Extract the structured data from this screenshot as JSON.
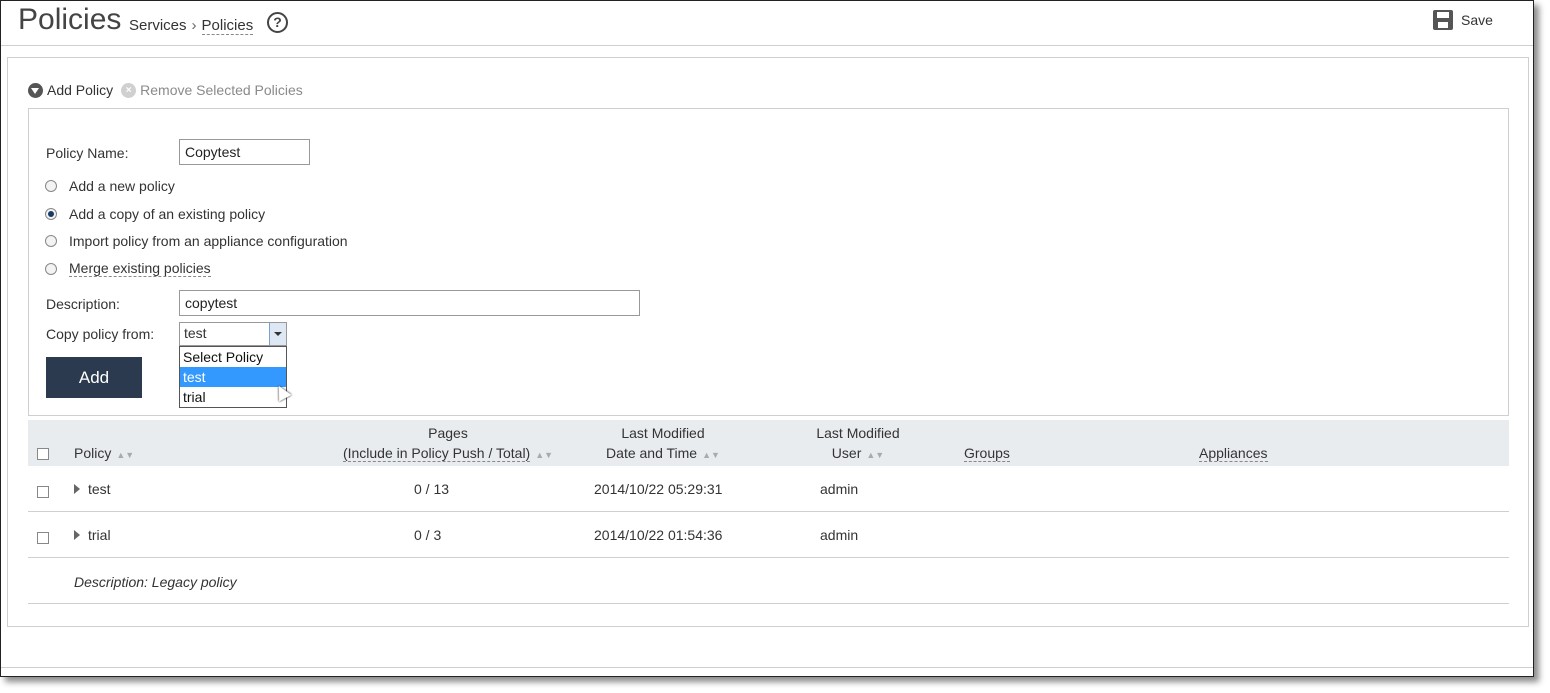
{
  "header": {
    "title": "Policies",
    "breadcrumb": {
      "parent": "Services",
      "separator": "›",
      "current": "Policies"
    },
    "help_icon": "?",
    "save_label": "Save"
  },
  "actions": {
    "add_policy": "Add Policy",
    "remove_selected": "Remove Selected Policies"
  },
  "form": {
    "policy_name_label": "Policy Name:",
    "policy_name_value": "Copytest",
    "radio_options": [
      {
        "label": "Add a new policy",
        "checked": false
      },
      {
        "label": "Add a copy of an existing policy",
        "checked": true
      },
      {
        "label": "Import policy from an appliance configuration",
        "checked": false
      },
      {
        "label": "Merge existing policies",
        "checked": false
      }
    ],
    "description_label": "Description:",
    "description_value": "copytest",
    "copy_from_label": "Copy policy from:",
    "copy_from_value": "test",
    "dropdown_options": [
      {
        "label": "Select Policy",
        "selected": false
      },
      {
        "label": "test",
        "selected": true
      },
      {
        "label": "trial",
        "selected": false
      }
    ],
    "add_button": "Add"
  },
  "table": {
    "headers": {
      "policy": "Policy",
      "pages_line1": "Pages",
      "pages_line2": "(Include in Policy Push / Total)",
      "modified_line1": "Last Modified",
      "modified_line2": "Date and Time",
      "user_line1": "Last Modified",
      "user_line2": "User",
      "groups": "Groups",
      "appliances": "Appliances"
    },
    "rows": [
      {
        "policy": "test",
        "pages": "0 / 13",
        "modified": "2014/10/22 05:29:31",
        "user": "admin"
      },
      {
        "policy": "trial",
        "pages": "0 / 3",
        "modified": "2014/10/22 01:54:36",
        "user": "admin"
      }
    ],
    "expanded_description": "Description: Legacy policy"
  },
  "colors": {
    "button_bg": "#2b3a4e",
    "header_bg": "#e9ecef",
    "selected_option": "#3399ff"
  },
  "icons": {
    "save": "save-disk-icon",
    "help": "help-circle-icon",
    "add": "chevron-down-circle-icon",
    "remove": "x-circle-icon"
  }
}
